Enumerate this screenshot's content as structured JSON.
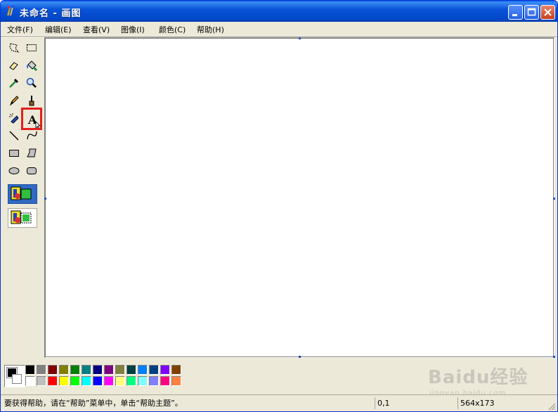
{
  "window": {
    "title": "未命名 - 画图",
    "icon": "paint-app-icon"
  },
  "menubar": {
    "items": [
      {
        "label": "文件(F)"
      },
      {
        "label": "编辑(E)"
      },
      {
        "label": "查看(V)"
      },
      {
        "label": "图像(I)"
      },
      {
        "label": "颜色(C)"
      },
      {
        "label": "帮助(H)"
      }
    ]
  },
  "toolbox": {
    "tools": [
      {
        "name": "free-form-select",
        "icon": "free-select-icon"
      },
      {
        "name": "select",
        "icon": "rect-select-icon"
      },
      {
        "name": "eraser",
        "icon": "eraser-icon"
      },
      {
        "name": "fill-with-color",
        "icon": "fill-bucket-icon"
      },
      {
        "name": "pick-color",
        "icon": "eyedropper-icon"
      },
      {
        "name": "magnifier",
        "icon": "magnifier-icon"
      },
      {
        "name": "pencil",
        "icon": "pencil-icon"
      },
      {
        "name": "brush",
        "icon": "brush-icon"
      },
      {
        "name": "airbrush",
        "icon": "airbrush-icon"
      },
      {
        "name": "text",
        "icon": "text-tool-icon",
        "glyph": "A",
        "selected": true
      },
      {
        "name": "line",
        "icon": "line-icon"
      },
      {
        "name": "curve",
        "icon": "curve-icon"
      },
      {
        "name": "rectangle",
        "icon": "rectangle-icon"
      },
      {
        "name": "polygon",
        "icon": "polygon-icon"
      },
      {
        "name": "ellipse",
        "icon": "ellipse-icon"
      },
      {
        "name": "rounded-rectangle",
        "icon": "rounded-rect-icon"
      }
    ],
    "options": [
      "opaque-background-icon",
      "transparent-background-icon"
    ]
  },
  "colors": {
    "foreground": "#000000",
    "background": "#ffffff",
    "palette_top": [
      "#000000",
      "#808080",
      "#800000",
      "#808000",
      "#008000",
      "#008080",
      "#000080",
      "#800080",
      "#808040",
      "#004040",
      "#0080ff",
      "#004080",
      "#8000ff",
      "#804000"
    ],
    "palette_bottom": [
      "#ffffff",
      "#c0c0c0",
      "#ff0000",
      "#ffff00",
      "#00ff00",
      "#00ffff",
      "#0000ff",
      "#ff00ff",
      "#ffff80",
      "#00ff80",
      "#80ffff",
      "#8080ff",
      "#ff0080",
      "#ff8040"
    ]
  },
  "statusbar": {
    "help_text": "要获得帮助，请在“帮助”菜单中，单击“帮助主题”。",
    "cursor_pos": "0,1",
    "canvas_size": "564x173"
  },
  "watermark": {
    "brand": "Baidu经验",
    "url": "jingyan.baidu.com"
  }
}
